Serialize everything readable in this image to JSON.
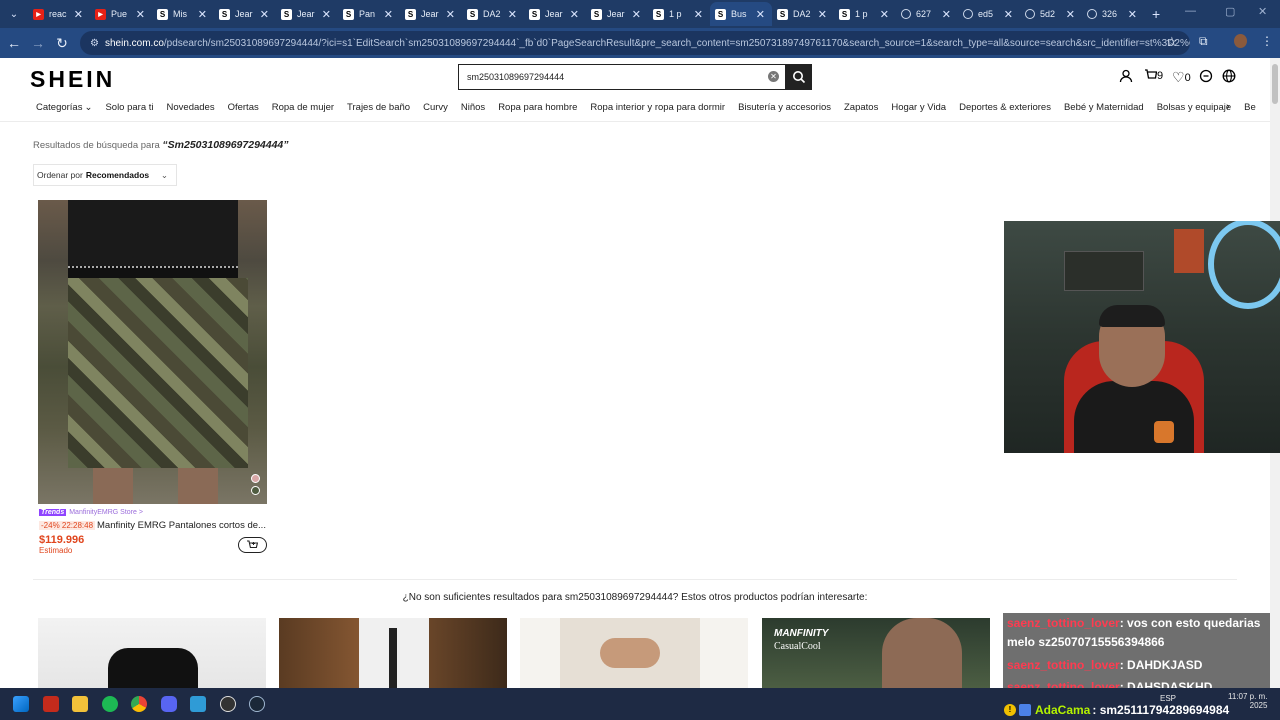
{
  "browser": {
    "tabs": [
      {
        "favicon": "youtube-icon",
        "label": "reac"
      },
      {
        "favicon": "youtube-icon",
        "label": "Pue"
      },
      {
        "favicon": "shein-icon",
        "label": "Mis"
      },
      {
        "favicon": "shein-icon",
        "label": "Jear"
      },
      {
        "favicon": "shein-icon",
        "label": "Jear"
      },
      {
        "favicon": "shein-icon",
        "label": "Pan"
      },
      {
        "favicon": "shein-icon",
        "label": "Jear"
      },
      {
        "favicon": "shein-icon",
        "label": "DA2"
      },
      {
        "favicon": "shein-icon",
        "label": "Jear"
      },
      {
        "favicon": "shein-icon",
        "label": "Jear"
      },
      {
        "favicon": "shein-icon",
        "label": "1 p"
      },
      {
        "favicon": "shein-icon",
        "label": "Bus",
        "active": true
      },
      {
        "favicon": "shein-icon",
        "label": "DA2"
      },
      {
        "favicon": "shein-icon",
        "label": "1 p"
      },
      {
        "favicon": "globe-icon",
        "label": "627"
      },
      {
        "favicon": "globe-icon",
        "label": "ed5"
      },
      {
        "favicon": "globe-icon",
        "label": "5d2"
      },
      {
        "favicon": "globe-icon",
        "label": "326"
      }
    ],
    "url_host": "shein.com.co",
    "url_rest": "/pdsearch/sm25031089697294444/?ici=s1`EditSearch`sm25031089697294444`_fb`d0`PageSearchResult&pre_search_content=sm25073189749761170&search_source=1&search_type=all&source=search&src_identifier=st%3D2%60sc%3Dsm25..."
  },
  "site": {
    "logo": "SHEIN",
    "search_value": "sm25031089697294444",
    "cart_count": "9",
    "wishlist_count": "0",
    "categories": [
      "Categorías",
      "Solo para ti",
      "Novedades",
      "Ofertas",
      "Ropa de mujer",
      "Trajes de baño",
      "Curvy",
      "Niños",
      "Ropa para hombre",
      "Ropa interior y ropa para dormir",
      "Bisutería y accesorios",
      "Zapatos",
      "Hogar y Vida",
      "Deportes & exteriores",
      "Bebé y Maternidad",
      "Bolsas y equipaje",
      "Be"
    ],
    "results_prefix": "Resultados de búsqueda para",
    "results_term": "“Sm25031089697294444”",
    "sort_label": "Ordenar por",
    "sort_value": "Recomendados",
    "product": {
      "badge": "Trends",
      "store": "ManfinityEMRG Store >",
      "discount": "-24% 22:28:48",
      "name": "Manfinity EMRG Pantalones cortos de...",
      "price": "$119.996",
      "price_note": "Estimado"
    },
    "not_enough": "¿No son suficientes resultados para sm25031089697294444? Estos otros productos podrían interesarte:",
    "thumb4_brand1": "MANFINITY",
    "thumb4_brand2": "CasualCool"
  },
  "stream": {
    "chat": [
      {
        "user": "saenz_tottino_lover",
        "text": ": vos con esto quedarias"
      },
      {
        "user": "",
        "text": "melo sz25070715556394866"
      },
      {
        "user": "saenz_tottino_lover",
        "text": ": DAHDKJASD"
      },
      {
        "user": "saenz_tottino_lover",
        "text": ": DAHSDASKHD"
      }
    ],
    "ticker_name": "AdaCama",
    "ticker_text": ": sm25111794289694984"
  },
  "taskbar": {
    "lang": "ESP",
    "time": "11:07 p. m.",
    "date": "2025"
  },
  "colors": {
    "accent": "#e0461e",
    "trends": "#8f44ff",
    "browser": "#254a82"
  }
}
